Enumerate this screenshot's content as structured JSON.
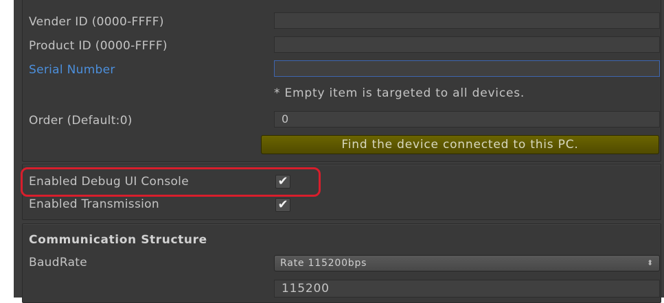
{
  "device": {
    "vendor_id_label": "Vender ID (0000-FFFF)",
    "vendor_id_value": "",
    "product_id_label": "Product ID (0000-FFFF)",
    "product_id_value": "",
    "serial_number_label": "Serial Number",
    "serial_number_value": "",
    "empty_note": "* Empty item is targeted to all devices.",
    "order_label": "Order (Default:0)",
    "order_value": "0",
    "find_button_label": "Find the device connected to this PC."
  },
  "options": {
    "debug_console_label": "Enabled Debug UI Console",
    "debug_console_checked": true,
    "transmission_label": "Enabled Transmission",
    "transmission_checked": true,
    "checkmark_glyph": "✔"
  },
  "communication": {
    "section_title": "Communication Structure",
    "baudrate_label": "BaudRate",
    "baudrate_selected": "Rate 115200bps",
    "baudrate_value": "115200",
    "dropdown_arrow": "⬍"
  },
  "colors": {
    "panel_bg": "#3c3c3c",
    "label_text": "#c4c4c4",
    "active_label": "#4c8fdc",
    "find_button": "#5e5800",
    "highlight_ring": "#d81e2c"
  }
}
